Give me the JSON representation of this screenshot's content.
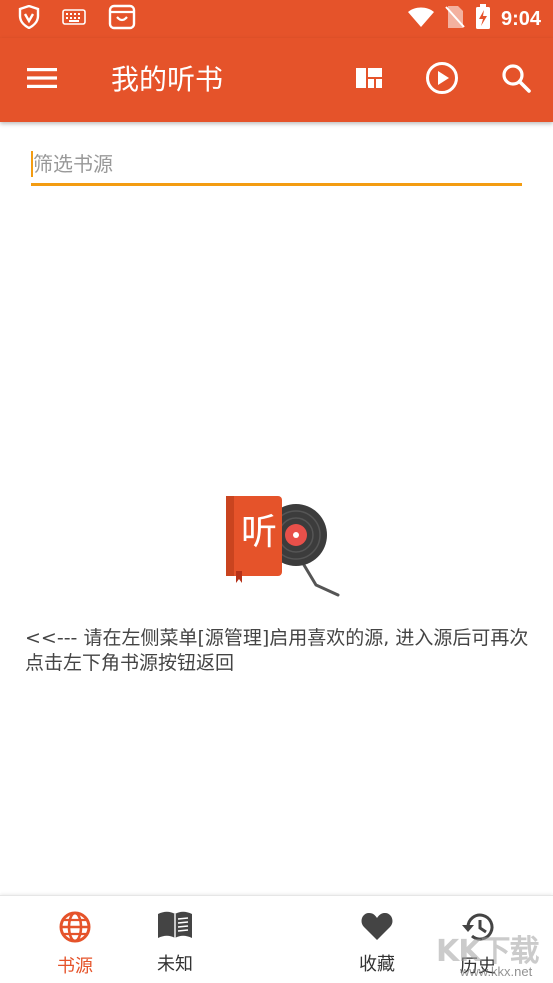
{
  "status_bar": {
    "time": "9:04",
    "icons": [
      "vpn-shield-icon",
      "keyboard-icon",
      "shopping-bag-icon",
      "wifi-icon",
      "no-sim-icon",
      "battery-charging-icon"
    ]
  },
  "app_bar": {
    "title": "我的听书",
    "actions": [
      "layout-icon",
      "play-circle-icon",
      "search-icon"
    ]
  },
  "filter": {
    "placeholder": "筛选书源",
    "value": ""
  },
  "empty_state": {
    "illustration_text": "听",
    "message": "<<--- 请在左侧菜单[源管理]启用喜欢的源, 进入源后可再次点击左下角书源按钮返回"
  },
  "bottom_nav": {
    "items": [
      {
        "label": "书源",
        "icon": "globe-icon",
        "active": true
      },
      {
        "label": "未知",
        "icon": "book-icon",
        "active": false
      },
      {
        "label": "收藏",
        "icon": "heart-icon",
        "active": false
      },
      {
        "label": "历史",
        "icon": "history-icon",
        "active": false
      }
    ]
  },
  "watermark": {
    "text": "KK下载",
    "url": "www.kkx.net"
  },
  "colors": {
    "primary": "#e5532a",
    "accent": "#f39c12",
    "text": "#444444",
    "icon_dark": "#444444"
  }
}
